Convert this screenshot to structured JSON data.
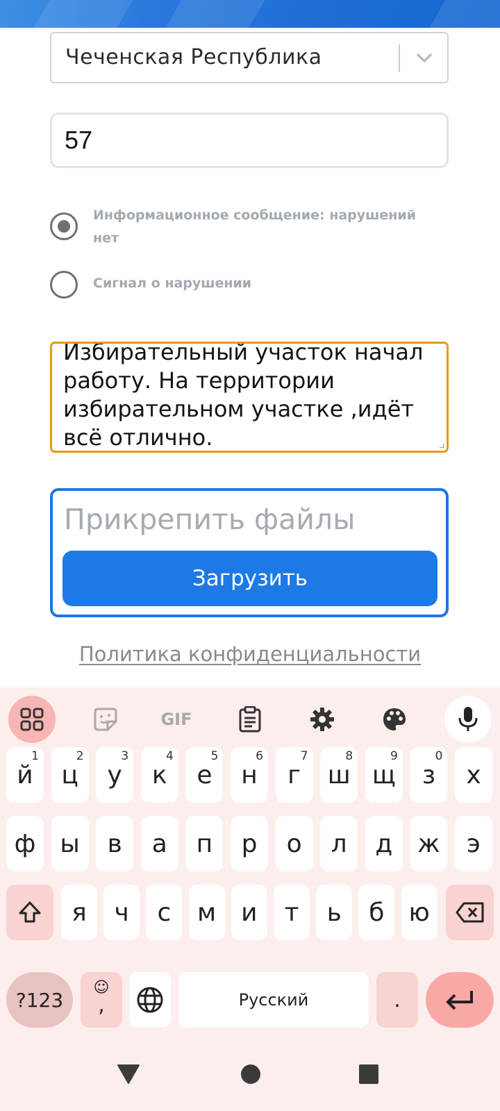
{
  "form": {
    "region_select": {
      "value": "Чеченская Республика",
      "icon": "chevron-down-icon"
    },
    "station_number": {
      "value": "57"
    },
    "report_type": {
      "options": [
        {
          "label": "Информационное сообщение: нарушений нет",
          "selected": true
        },
        {
          "label": "Сигнал о нарушении",
          "selected": false
        }
      ]
    },
    "message": {
      "value": "Избирательный участок начал работу. На территории избирательном участке ,идёт всё отлично.",
      "border_color": "#e39a1a"
    },
    "attachments": {
      "placeholder": "Прикрепить файлы",
      "upload_label": "Загрузить",
      "accent": "#1d79e6"
    },
    "privacy_link": "Политика конфиденциальности"
  },
  "keyboard": {
    "toolbar": [
      "apps-grid-icon",
      "sticker-icon",
      "GIF",
      "clipboard-icon",
      "settings-gear-icon",
      "palette-icon",
      "microphone-icon"
    ],
    "gif_label": "GIF",
    "row1": [
      {
        "k": "й",
        "h": "1"
      },
      {
        "k": "ц",
        "h": "2"
      },
      {
        "k": "у",
        "h": "3"
      },
      {
        "k": "к",
        "h": "4"
      },
      {
        "k": "е",
        "h": "5"
      },
      {
        "k": "н",
        "h": "6"
      },
      {
        "k": "г",
        "h": "7"
      },
      {
        "k": "ш",
        "h": "8"
      },
      {
        "k": "щ",
        "h": "9"
      },
      {
        "k": "з",
        "h": "0"
      },
      {
        "k": "х",
        "h": ""
      }
    ],
    "row2": [
      "ф",
      "ы",
      "в",
      "а",
      "п",
      "р",
      "о",
      "л",
      "д",
      "ж",
      "э"
    ],
    "row3": [
      "я",
      "ч",
      "с",
      "м",
      "и",
      "т",
      "ь",
      "б",
      "ю"
    ],
    "symbols_label": "?123",
    "emoji_comma": ",",
    "space_label": "Русский",
    "period_label": ".",
    "key_bg": "#ffffff",
    "special_key_bg": "#f8d3d1",
    "background": "#fceeec"
  },
  "navigation": [
    "back-triangle-icon",
    "home-circle-icon",
    "recents-square-icon"
  ]
}
